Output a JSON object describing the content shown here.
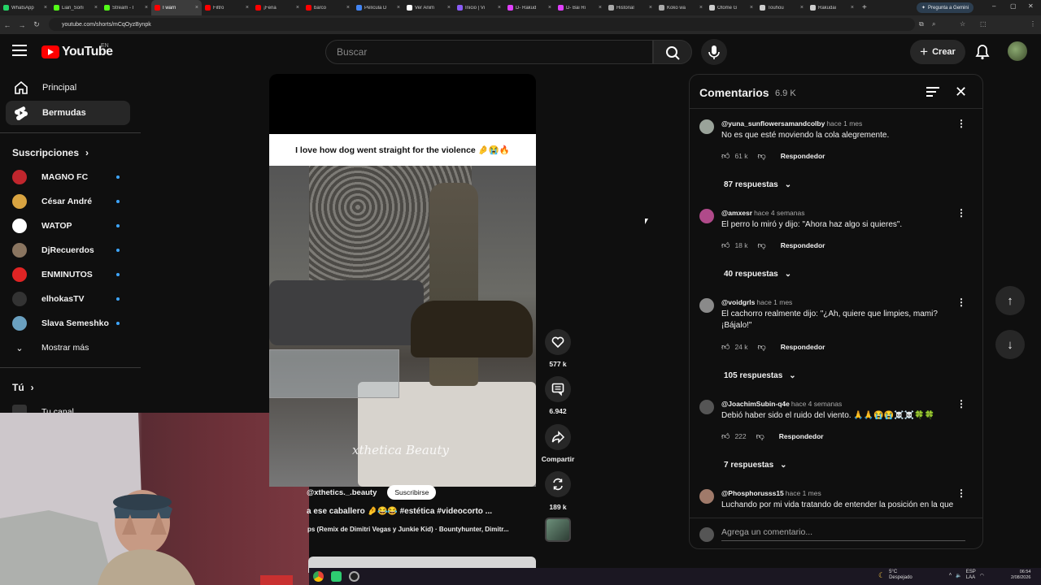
{
  "browser": {
    "tabs": [
      {
        "label": "WhatsApp",
        "color": "#25d366",
        "active": false
      },
      {
        "label": "Lian_Sorli",
        "color": "#53fc18",
        "active": false
      },
      {
        "label": "Stream - I",
        "color": "#53fc18",
        "active": false
      },
      {
        "label": "I warn",
        "color": "#ff0000",
        "active": true
      },
      {
        "label": "Filtro",
        "color": "#ff0000",
        "active": false
      },
      {
        "label": "¡Fena",
        "color": "#ff0000",
        "active": false
      },
      {
        "label": "barco",
        "color": "#ff0000",
        "active": false
      },
      {
        "label": "Película D",
        "color": "#4285f4",
        "active": false
      },
      {
        "label": "Ver Anim",
        "color": "#ffffff",
        "active": false
      },
      {
        "label": "Inicio | Vi",
        "color": "#8a5cf6",
        "active": false
      },
      {
        "label": "D- Rakud",
        "color": "#e040fb",
        "active": false
      },
      {
        "label": "D- Bai Ri",
        "color": "#e040fb",
        "active": false
      },
      {
        "label": "Historial",
        "color": "#aaaaaa",
        "active": false
      },
      {
        "label": "Koko wa",
        "color": "#aaaaaa",
        "active": false
      },
      {
        "label": "Otome G",
        "color": "#cccccc",
        "active": false
      },
      {
        "label": "Touhou",
        "color": "#cccccc",
        "active": false
      },
      {
        "label": "Rakudai",
        "color": "#cccccc",
        "active": false
      }
    ],
    "new_tab": "+",
    "gemini_label": "Pregunta a Gemini",
    "url": "youtube.com/shorts/mCqOyzBynpk"
  },
  "header": {
    "logo_text": "YouTube",
    "region": "EN",
    "search_placeholder": "Buscar",
    "create_label": "Crear"
  },
  "sidebar": {
    "nav": [
      {
        "label": "Principal",
        "icon": "home-icon",
        "selected": false
      },
      {
        "label": "Bermudas",
        "icon": "shorts-icon",
        "selected": true
      }
    ],
    "subscriptions_title": "Suscripciones",
    "subscriptions": [
      {
        "name": "MAGNO FC",
        "color": "#c0262d"
      },
      {
        "name": "César André",
        "color": "#d9a441"
      },
      {
        "name": "WATOP",
        "color": "#ffffff"
      },
      {
        "name": "DjRecuerdos",
        "color": "#8a7560"
      },
      {
        "name": "ENMINUTOS",
        "color": "#e02424"
      },
      {
        "name": "elhokasTV",
        "color": "#333333"
      },
      {
        "name": "Slava Semeshko",
        "color": "#6aa0c0"
      }
    ],
    "show_more": "Mostrar más",
    "you_title": "Tú",
    "your_channel": "Tu canal"
  },
  "video": {
    "caption": "I love how dog went straight for the violence 🤌😭🔥",
    "watermark": "xthetica Beauty",
    "handle": "@xthetics._.beauty",
    "subscribe_label": "Suscribirse",
    "description": "a ese caballero 🤌😂😂 #estética #videocorto ...",
    "music": "ps (Remix de Dimitri Vegas y Junkie Kid) · Bountyhunter, Dimitr..."
  },
  "actions": {
    "likes": "577 k",
    "comments": "6.942",
    "share": "Compartir",
    "remix": "189 k"
  },
  "comments_panel": {
    "title": "Comentarios",
    "count": "6.9 K",
    "add_placeholder": "Agrega un comentario...",
    "items": [
      {
        "author": "@yuna_sunflowersamandcolby",
        "time": "hace 1 mes",
        "text": "No es que esté moviendo la cola alegremente.",
        "likes": "61 k",
        "reply": "Respondedor",
        "replies": "87 respuestas",
        "avatar": "#9aa39a"
      },
      {
        "author": "@amxesr",
        "time": "hace 4 semanas",
        "text": "El perro lo miró y dijo: \"Ahora haz algo si quieres\".",
        "likes": "18 k",
        "reply": "Respondedor",
        "replies": "40 respuestas",
        "avatar": "#b04a8a"
      },
      {
        "author": "@voidgrls",
        "time": "hace 1 mes",
        "text": "El cachorro realmente dijo: \"¿Ah, quiere que limpies, mami? ¡Bájalo!\"",
        "likes": "24 k",
        "reply": "Respondedor",
        "replies": "105 respuestas",
        "avatar": "#8a8a8a"
      },
      {
        "author": "@JoachimSubin-q4e",
        "time": "hace 4 semanas",
        "text": "Debió haber sido el ruido del viento. 🙏🙏😭😭☠️☠️🍀🍀",
        "likes": "222",
        "reply": "Respondedor",
        "replies": "7 respuestas",
        "avatar": "#555555"
      },
      {
        "author": "@Phosphorusss15",
        "time": "hace 1 mes",
        "text": "Luchando por mi vida tratando de entender la posición en la que",
        "likes": "",
        "reply": "",
        "replies": "",
        "avatar": "#a07a6a"
      }
    ]
  },
  "taskbar": {
    "weather_temp": "5°C",
    "weather_text": "Despejado",
    "lang": "ESP",
    "lang2": "LAA",
    "time": "06:54",
    "date": "2/08/2026"
  }
}
